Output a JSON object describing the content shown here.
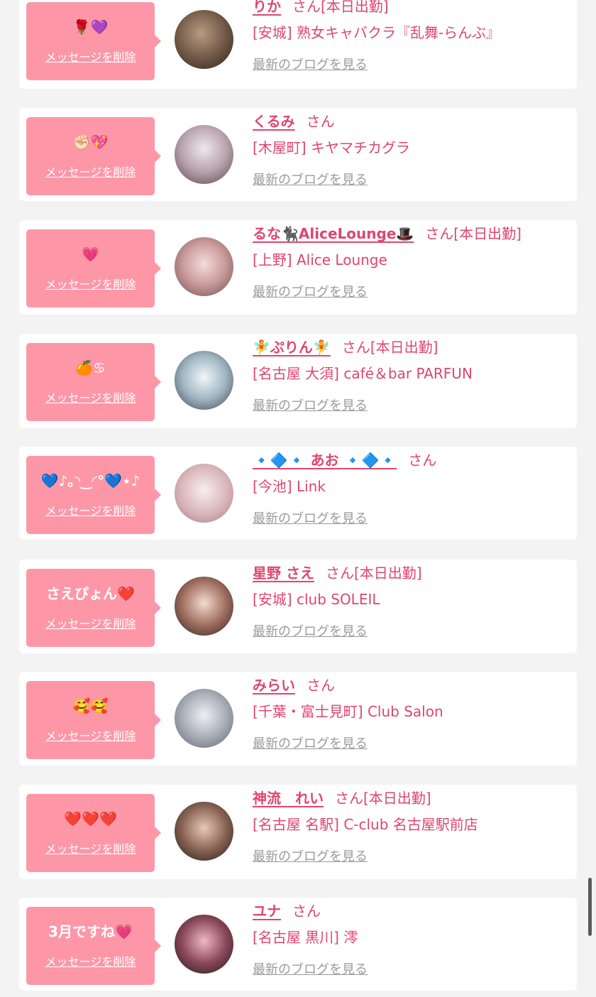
{
  "delete_label": "メッセージを削除",
  "blog_label": "最新のブログを見る",
  "honorific": "さん",
  "colors": {
    "accent": "#e0456e",
    "bubble": "#fd97a8",
    "background": "#f3f3f3"
  },
  "items": [
    {
      "message": "🌹💜",
      "name": "りか",
      "status": "[本日出勤]",
      "shop": "[安城] 熟女キャバクラ『乱舞-らんぶ』",
      "avatar": "avatar-photo"
    },
    {
      "message": "✊🏻💖",
      "name": "くるみ",
      "status": "",
      "shop": "[木屋町] キヤマチカグラ",
      "avatar": "avatar-photo"
    },
    {
      "message": "💗",
      "name": "るな🐈‍⬛AliceLounge🎩",
      "status": "[本日出勤]",
      "shop": "[上野] Alice Lounge",
      "avatar": "avatar-photo"
    },
    {
      "message": "🍊♋",
      "name": "🧚ぷりん🧚",
      "status": "[本日出勤]",
      "shop": "[名古屋 大須] café＆bar PARFUN",
      "avatar": "avatar-photo"
    },
    {
      "message": "💙♪｡◝‿◜°💙⋆♪",
      "name": "🔹🔷🔹 あお 🔹🔷🔹",
      "status": "",
      "shop": "[今池] Link",
      "avatar": "avatar-illustration"
    },
    {
      "message": "さえぴょん❤️",
      "name": "星野 さえ",
      "status": "[本日出勤]",
      "shop": "[安城] club SOLEIL",
      "avatar": "avatar-photo"
    },
    {
      "message": "🥰🥰",
      "name": "みらい",
      "status": "",
      "shop": "[千葉・富士見町] Club Salon",
      "avatar": "avatar-photo"
    },
    {
      "message": "❤️❤️❤️",
      "name": "神流　れい",
      "status": "[本日出勤]",
      "shop": "[名古屋 名駅] C-club 名古屋駅前店",
      "avatar": "avatar-photo"
    },
    {
      "message": "3月ですね💗",
      "name": "ユナ",
      "status": "",
      "shop": "[名古屋 黒川] 澪",
      "avatar": "avatar-photo"
    }
  ]
}
